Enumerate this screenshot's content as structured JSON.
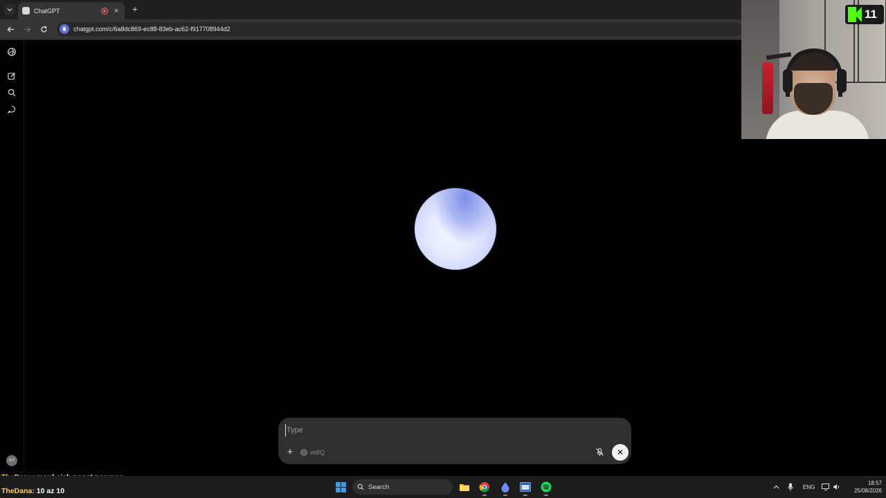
{
  "browser": {
    "tab_title": "ChatGPT",
    "tab_close": "×",
    "new_tab": "+",
    "url": "chatgpt.com/c/6a8dc869-ec88-83eb-ac62-f917708944d2"
  },
  "sidebar": {
    "avatar_initials": "WY"
  },
  "composer": {
    "placeholder": "Type",
    "plus": "+",
    "tool_chip_label": "vidIQ",
    "end_button": "✕"
  },
  "overlay": {
    "badge_number": "11",
    "chat": [
      {
        "user": "TheDana:",
        "message": "mard siah poost por moo"
      },
      {
        "user": "TheDana:",
        "message": "10 az 10"
      }
    ]
  },
  "taskbar": {
    "search_label": "Search",
    "language": "ENG",
    "time": "18:57",
    "date": "25/08/2026"
  }
}
